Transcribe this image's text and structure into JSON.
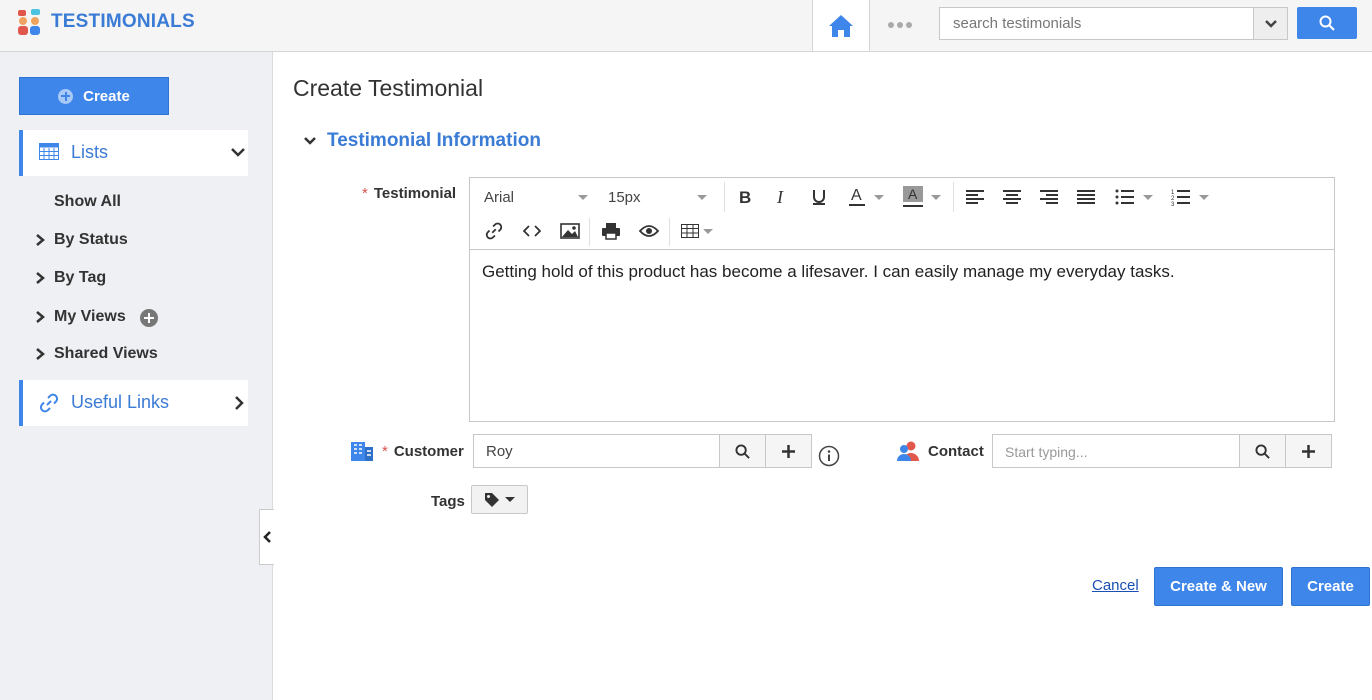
{
  "header": {
    "app_title": "TESTIMONIALS",
    "search_placeholder": "search testimonials",
    "accent": "#3f86ea"
  },
  "sidebar": {
    "create_label": "Create",
    "lists_label": "Lists",
    "items": [
      {
        "label": "Show All"
      },
      {
        "label": "By Status"
      },
      {
        "label": "By Tag"
      },
      {
        "label": "My Views"
      },
      {
        "label": "Shared Views"
      }
    ],
    "useful_links_label": "Useful Links"
  },
  "main": {
    "page_title": "Create Testimonial",
    "section_title": "Testimonial Information",
    "testimonial": {
      "label": "Testimonial",
      "font": "Arial",
      "size": "15px",
      "value": "Getting hold of this product has become a lifesaver. I can easily manage my everyday tasks."
    },
    "customer": {
      "label": "Customer",
      "value": "Roy"
    },
    "contact": {
      "label": "Contact",
      "placeholder": "Start typing..."
    },
    "tags": {
      "label": "Tags"
    },
    "actions": {
      "cancel": "Cancel",
      "create_new": "Create & New",
      "create": "Create"
    }
  }
}
